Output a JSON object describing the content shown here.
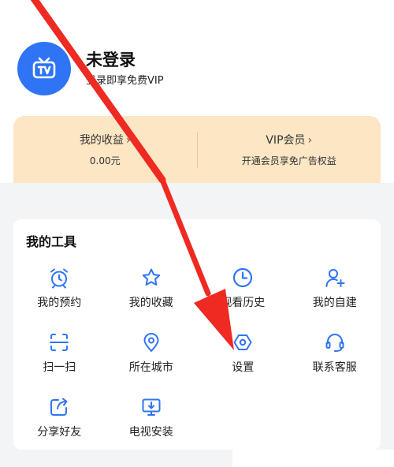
{
  "profile": {
    "username": "未登录",
    "login_hint": "登录即享免费VIP"
  },
  "vip_bar": {
    "earnings_title": "我的收益",
    "earnings_value": "0.00元",
    "vip_title": "VIP会员",
    "vip_sub": "开通会员享免广告权益"
  },
  "tools": {
    "title": "我的工具",
    "items": [
      {
        "label": "我的预约",
        "icon": "alarm-clock-icon"
      },
      {
        "label": "我的收藏",
        "icon": "star-icon"
      },
      {
        "label": "观看历史",
        "icon": "clock-icon"
      },
      {
        "label": "我的自建",
        "icon": "add-user-icon"
      },
      {
        "label": "扫一扫",
        "icon": "scan-icon"
      },
      {
        "label": "所在城市",
        "icon": "location-pin-icon"
      },
      {
        "label": "设置",
        "icon": "hexagon-settings-icon"
      },
      {
        "label": "联系客服",
        "icon": "headset-icon"
      },
      {
        "label": "分享好友",
        "icon": "share-icon"
      },
      {
        "label": "电视安装",
        "icon": "tv-install-icon"
      }
    ]
  },
  "colors": {
    "accent": "#2f74f5",
    "vip_bg": "#fde6c4",
    "annotation_arrow": "#ee2a23"
  }
}
